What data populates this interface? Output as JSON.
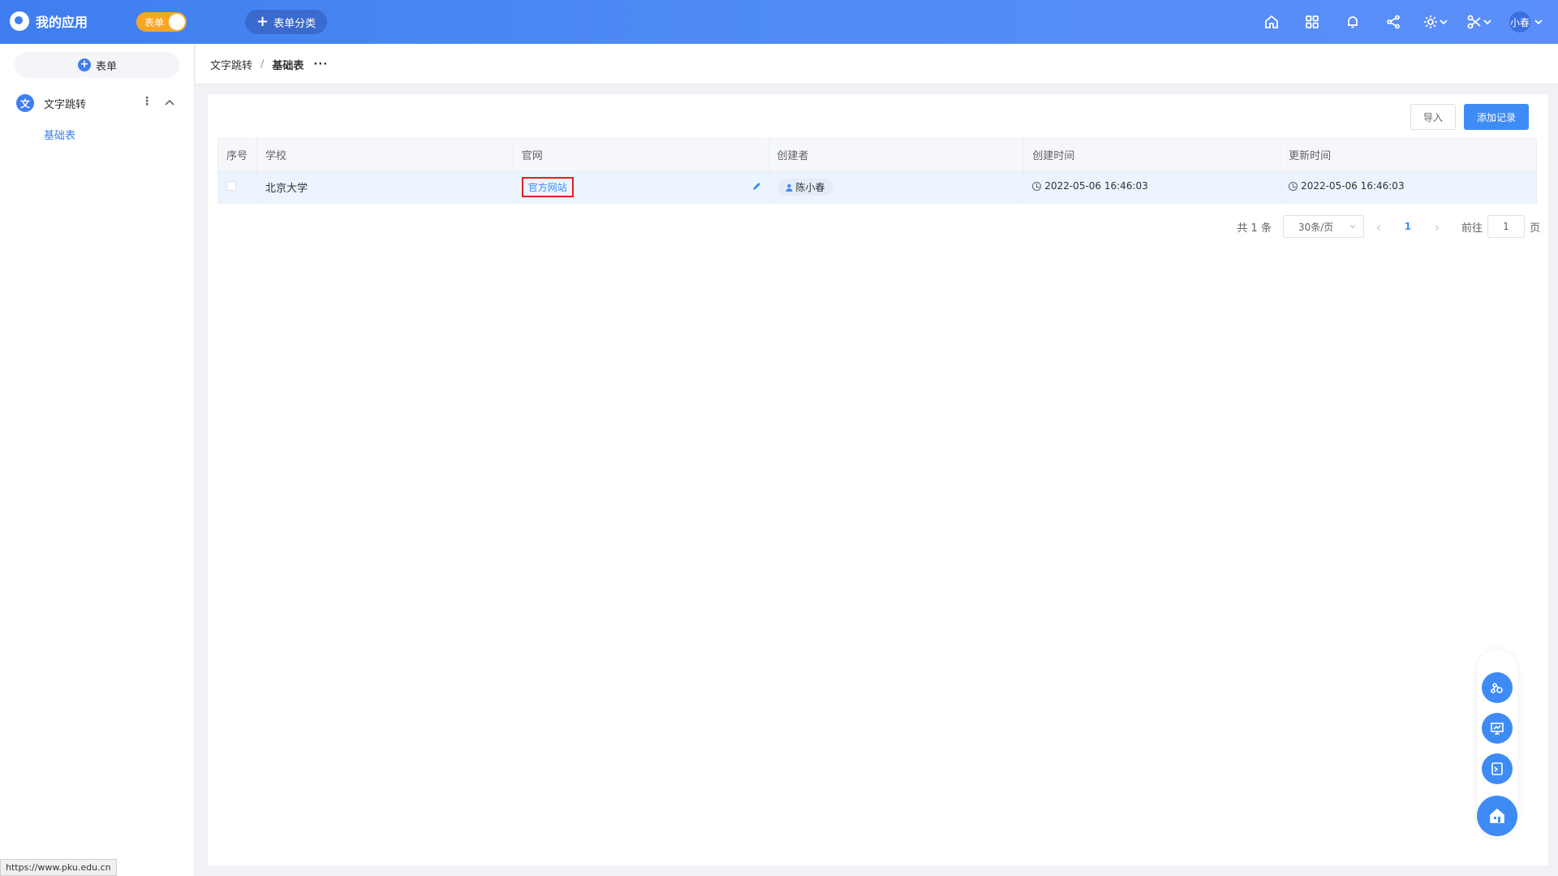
{
  "app": {
    "title": "我的应用",
    "toggle_label": "表单",
    "category_button": "表单分类",
    "user_name": "小春"
  },
  "topbar_icons": [
    "home-icon",
    "apps-grid-icon",
    "bell-icon",
    "share-icon",
    "gear-icon",
    "tools-icon"
  ],
  "sidebar": {
    "add_form_label": "表单",
    "group": {
      "icon_char": "文",
      "label": "文字跳转"
    },
    "sub_items": [
      {
        "label": "基础表"
      }
    ]
  },
  "breadcrumb": {
    "parent": "文字跳转",
    "separator": "/",
    "current": "基础表",
    "more": "···"
  },
  "toolbar": {
    "import_label": "导入",
    "add_label": "添加记录"
  },
  "table": {
    "headers": [
      "序号",
      "学校",
      "官网",
      "创建者",
      "创建时间",
      "更新时间"
    ],
    "rows": [
      {
        "school": "北京大学",
        "website_link": "官方网站",
        "creator": "陈小春",
        "created": "2022-05-06 16:46:03",
        "updated": "2022-05-06 16:46:03"
      }
    ]
  },
  "pagination": {
    "total": "共 1 条",
    "page_size": "30条/页",
    "current_page": "1",
    "goto_prefix": "前往",
    "goto_value": "1",
    "goto_suffix": "页"
  },
  "status_bar_url": "https://www.pku.edu.cn",
  "colors": {
    "primary": "#3f8bf5",
    "toggle": "#f6a623",
    "highlight_border": "#e02020"
  }
}
